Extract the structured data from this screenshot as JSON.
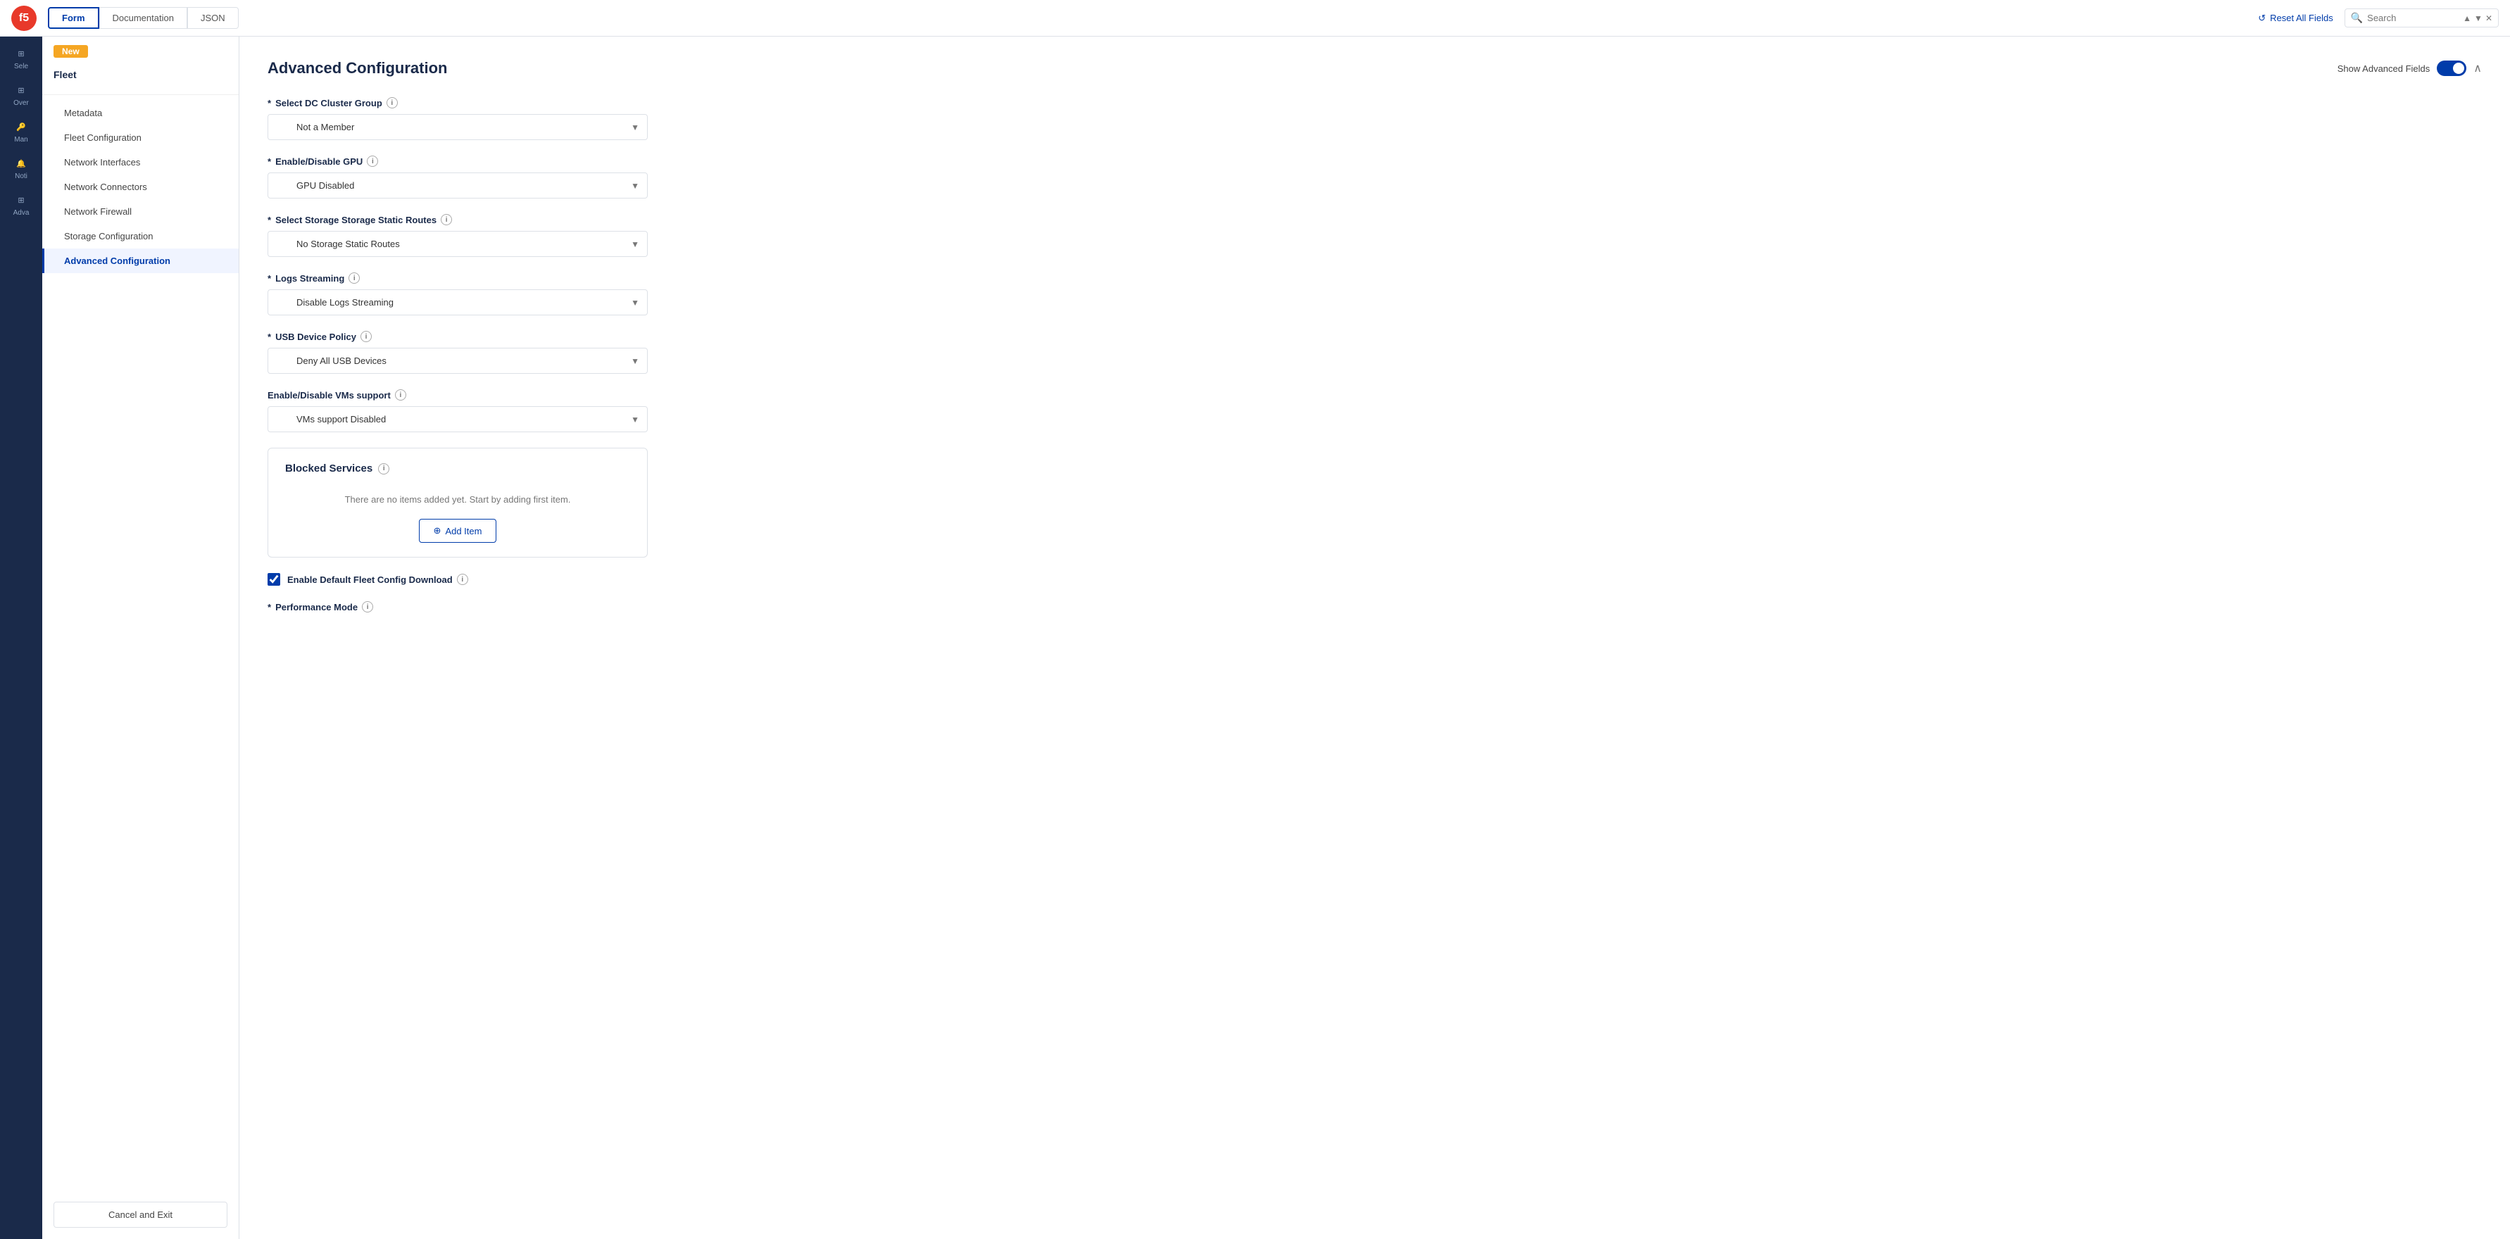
{
  "topbar": {
    "logo_text": "f5",
    "tabs": [
      {
        "id": "form",
        "label": "Form",
        "active": true
      },
      {
        "id": "documentation",
        "label": "Documentation",
        "active": false
      },
      {
        "id": "json",
        "label": "JSON",
        "active": false
      }
    ],
    "reset_label": "Reset All Fields",
    "search_placeholder": "Search"
  },
  "slim_sidebar": {
    "items": [
      {
        "id": "home",
        "label": "Sele",
        "icon": "⊞"
      },
      {
        "id": "overview",
        "label": "Over",
        "icon": "⊞"
      },
      {
        "id": "manage",
        "label": "Man",
        "icon": "🔑"
      },
      {
        "id": "noti",
        "label": "Noti",
        "icon": "🔔"
      },
      {
        "id": "advanced",
        "label": "Adva",
        "icon": "⊞"
      }
    ]
  },
  "nav_sidebar": {
    "badge_label": "New",
    "section_title": "Fleet",
    "items": [
      {
        "id": "metadata",
        "label": "Metadata",
        "active": false
      },
      {
        "id": "fleet-configuration",
        "label": "Fleet Configuration",
        "active": false
      },
      {
        "id": "network-interfaces",
        "label": "Network Interfaces",
        "active": false
      },
      {
        "id": "network-connectors",
        "label": "Network Connectors",
        "active": false
      },
      {
        "id": "network-firewall",
        "label": "Network Firewall",
        "active": false
      },
      {
        "id": "storage-configuration",
        "label": "Storage Configuration",
        "active": false
      },
      {
        "id": "advanced-configuration",
        "label": "Advanced Configuration",
        "active": true
      }
    ],
    "cancel_exit_label": "Cancel and Exit"
  },
  "main": {
    "title": "Advanced Configuration",
    "show_advanced_label": "Show Advanced Fields",
    "fields": {
      "dc_cluster_group": {
        "label": "Select DC Cluster Group",
        "required": true,
        "value": "Not a Member",
        "options": [
          "Not a Member"
        ]
      },
      "enable_disable_gpu": {
        "label": "Enable/Disable GPU",
        "required": true,
        "value": "GPU Disabled",
        "options": [
          "GPU Disabled"
        ]
      },
      "storage_static_routes": {
        "label": "Select Storage Storage Static Routes",
        "required": true,
        "value": "No Storage Static Routes",
        "options": [
          "No Storage Static Routes"
        ]
      },
      "logs_streaming": {
        "label": "Logs Streaming",
        "required": true,
        "value": "Disable Logs Streaming",
        "options": [
          "Disable Logs Streaming"
        ]
      },
      "usb_device_policy": {
        "label": "USB Device Policy",
        "required": true,
        "value": "Deny All USB Devices",
        "options": [
          "Deny All USB Devices"
        ]
      },
      "vms_support": {
        "label": "Enable/Disable VMs support",
        "required": false,
        "value": "VMs support Disabled",
        "options": [
          "VMs support Disabled"
        ]
      }
    },
    "blocked_services": {
      "title": "Blocked Services",
      "empty_text": "There are no items added yet. Start by adding first item.",
      "add_item_label": "Add Item"
    },
    "enable_default_fleet": {
      "label": "Enable Default Fleet Config Download",
      "checked": true
    },
    "performance_mode": {
      "label": "Performance Mode"
    }
  }
}
